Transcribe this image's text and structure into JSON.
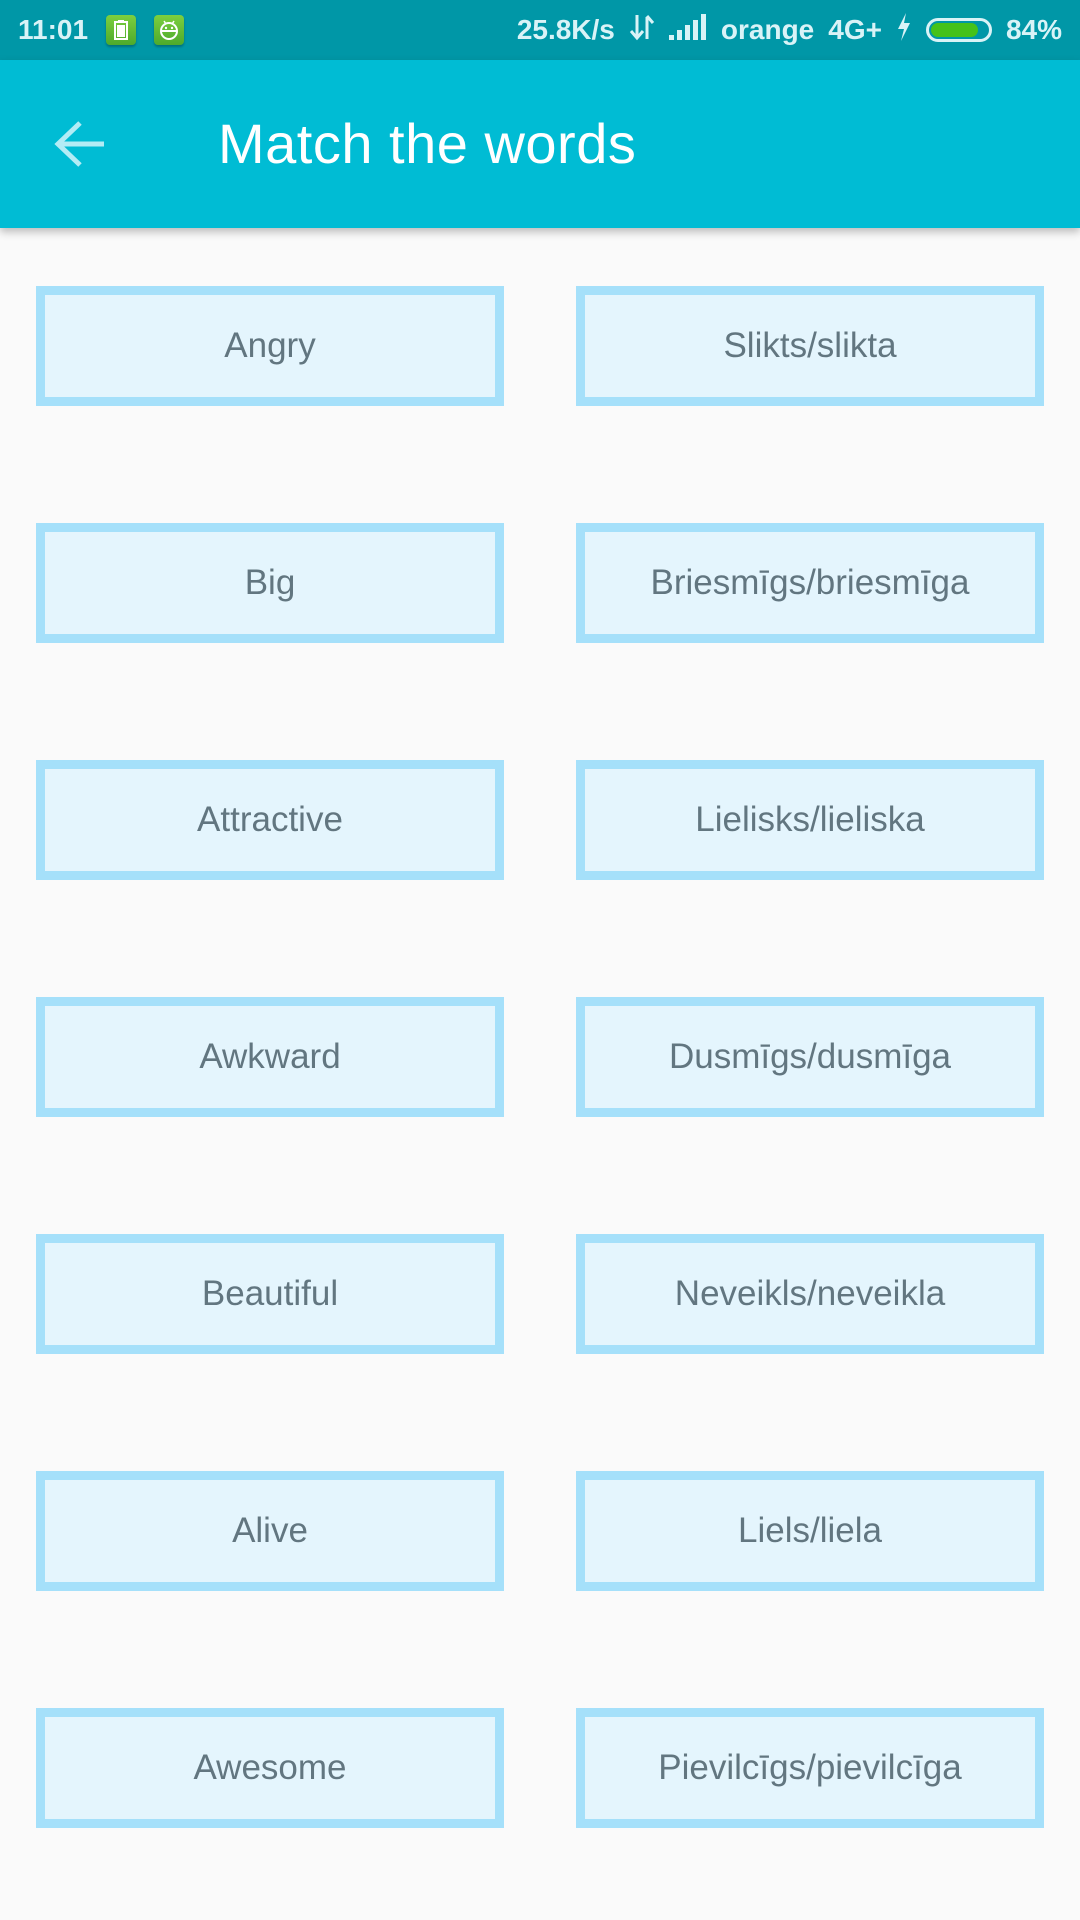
{
  "status_bar": {
    "time": "11:01",
    "notification_icons": [
      "battery-saver-icon",
      "android-robot-icon"
    ],
    "network_speed": "25.8K/s",
    "carrier": "orange",
    "network_type": "4G+",
    "battery_percent": "84%",
    "battery_level": 0.84,
    "charging": true,
    "colors": {
      "background": "#0097a7",
      "battery_fill": "#45c21a"
    }
  },
  "app_bar": {
    "title": "Match the words",
    "back_icon": "arrow-back-icon",
    "background_color": "#00bcd4"
  },
  "cards": {
    "colors": {
      "border": "#a5e0fa",
      "fill": "#e4f5fd",
      "text": "#627680"
    },
    "left": [
      "Angry",
      "Big",
      "Attractive",
      "Awkward",
      "Beautiful",
      "Alive",
      "Awesome"
    ],
    "right": [
      "Slikts/slikta",
      "Briesmīgs/briesmīga",
      "Lielisks/lieliska",
      "Dusmīgs/dusmīga",
      "Neveikls/neveikla",
      "Liels/liela",
      "Pievilcīgs/pievilcīga"
    ]
  }
}
